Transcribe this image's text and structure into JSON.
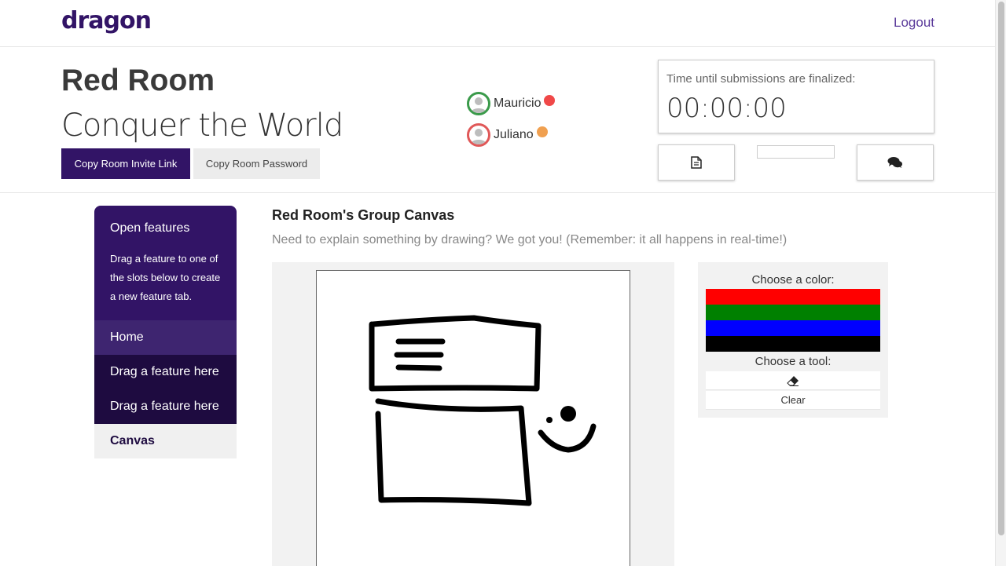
{
  "nav": {
    "brand": "dragon",
    "logout": "Logout"
  },
  "room": {
    "title": "Red Room",
    "subtitle": "Conquer the World",
    "invite_label": "Copy Room Invite Link",
    "password_label": "Copy Room Password"
  },
  "members": [
    {
      "name": "Mauricio",
      "ring_color": "#3a9a4a",
      "status_color": "#f04848"
    },
    {
      "name": "Juliano",
      "ring_color": "#e05858",
      "status_color": "#f0a050"
    }
  ],
  "timer": {
    "label": "Time until submissions are finalized:",
    "value": "00:00:00"
  },
  "sidebar": {
    "heading": "Open features",
    "description": "Drag a feature to one of the slots below to create a new feature tab.",
    "items": [
      {
        "label": "Home"
      },
      {
        "label": "Drag a feature here"
      },
      {
        "label": "Drag a feature here"
      },
      {
        "label": "Canvas"
      }
    ]
  },
  "canvas": {
    "title": "Red Room's Group Canvas",
    "description": "Need to explain something by drawing? We got you! (Remember: it all happens in real-time!)"
  },
  "tools": {
    "color_label": "Choose a color:",
    "colors": [
      "#ff0000",
      "#008000",
      "#0000ff",
      "#000000"
    ],
    "tool_label": "Choose a tool:",
    "eraser_icon": "eraser-icon",
    "clear_label": "Clear"
  },
  "icons": {
    "document": "document-icon",
    "chat": "chat-icon"
  }
}
